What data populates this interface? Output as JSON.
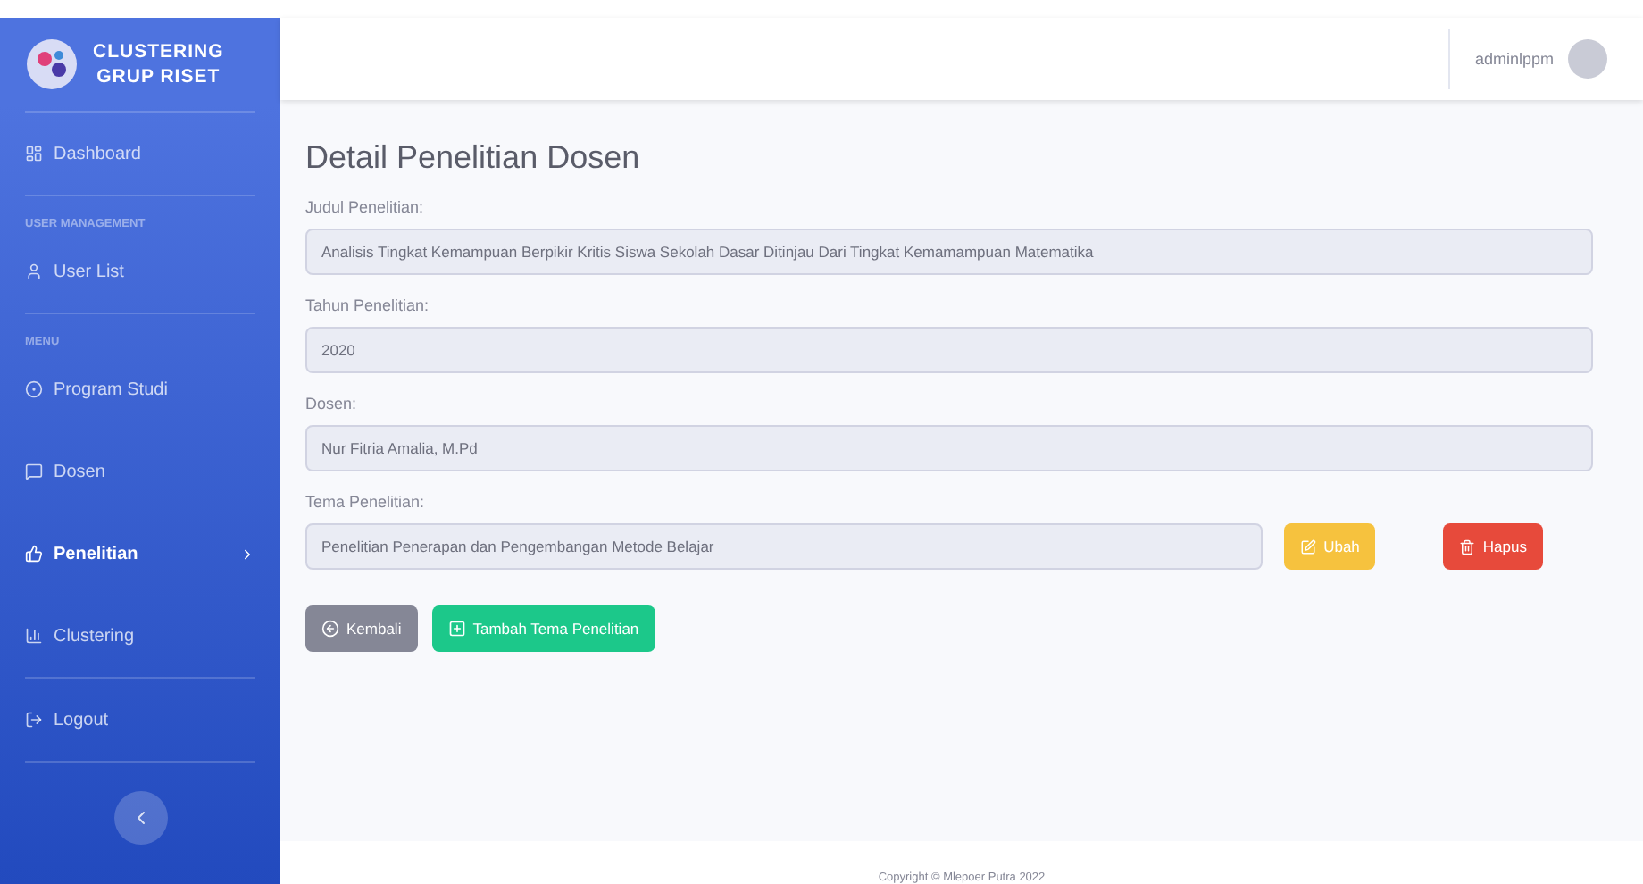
{
  "sidebar": {
    "brand": [
      "CLUSTERING",
      "GRUP RISET"
    ],
    "items": [
      {
        "kind": "link",
        "label": "Dashboard",
        "selected": false
      },
      {
        "kind": "divider"
      },
      {
        "kind": "heading",
        "label": "USER MANAGEMENT"
      },
      {
        "kind": "link",
        "label": "User List",
        "selected": false
      },
      {
        "kind": "divider"
      },
      {
        "kind": "heading",
        "label": "MENU"
      },
      {
        "kind": "link",
        "label": "Program Studi",
        "selected": false
      },
      {
        "kind": "link",
        "label": "Dosen",
        "selected": false
      },
      {
        "kind": "link",
        "label": "Penelitian",
        "selected": true,
        "expandable": true
      },
      {
        "kind": "link",
        "label": "Clustering",
        "selected": false
      },
      {
        "kind": "divider"
      },
      {
        "kind": "link",
        "label": "Logout",
        "selected": false
      },
      {
        "kind": "divider"
      }
    ]
  },
  "topbar": {
    "user": "adminlppm"
  },
  "page": {
    "title": "Detail Penelitian Dosen",
    "fields": [
      {
        "label": "Judul Penelitian:",
        "value": "Analisis Tingkat Kemampuan Berpikir Kritis Siswa Sekolah Dasar Ditinjau Dari Tingkat Kemamampuan Matematika"
      },
      {
        "label": "Tahun Penelitian:",
        "value": "2020"
      },
      {
        "label": "Dosen:",
        "value": "Nur Fitria Amalia, M.Pd"
      }
    ],
    "themes": {
      "label": "Tema Penelitian:",
      "rows": [
        {
          "value": "Penelitian Penerapan dan Pengembangan Metode Belajar",
          "edit": "Ubah",
          "delete": "Hapus"
        }
      ]
    },
    "actions": [
      {
        "kind": "back",
        "label": "Kembali"
      },
      {
        "kind": "add",
        "label": "Tambah Tema Penelitian"
      }
    ]
  },
  "footer": "Copyright © Mlepoer Putra 2022"
}
